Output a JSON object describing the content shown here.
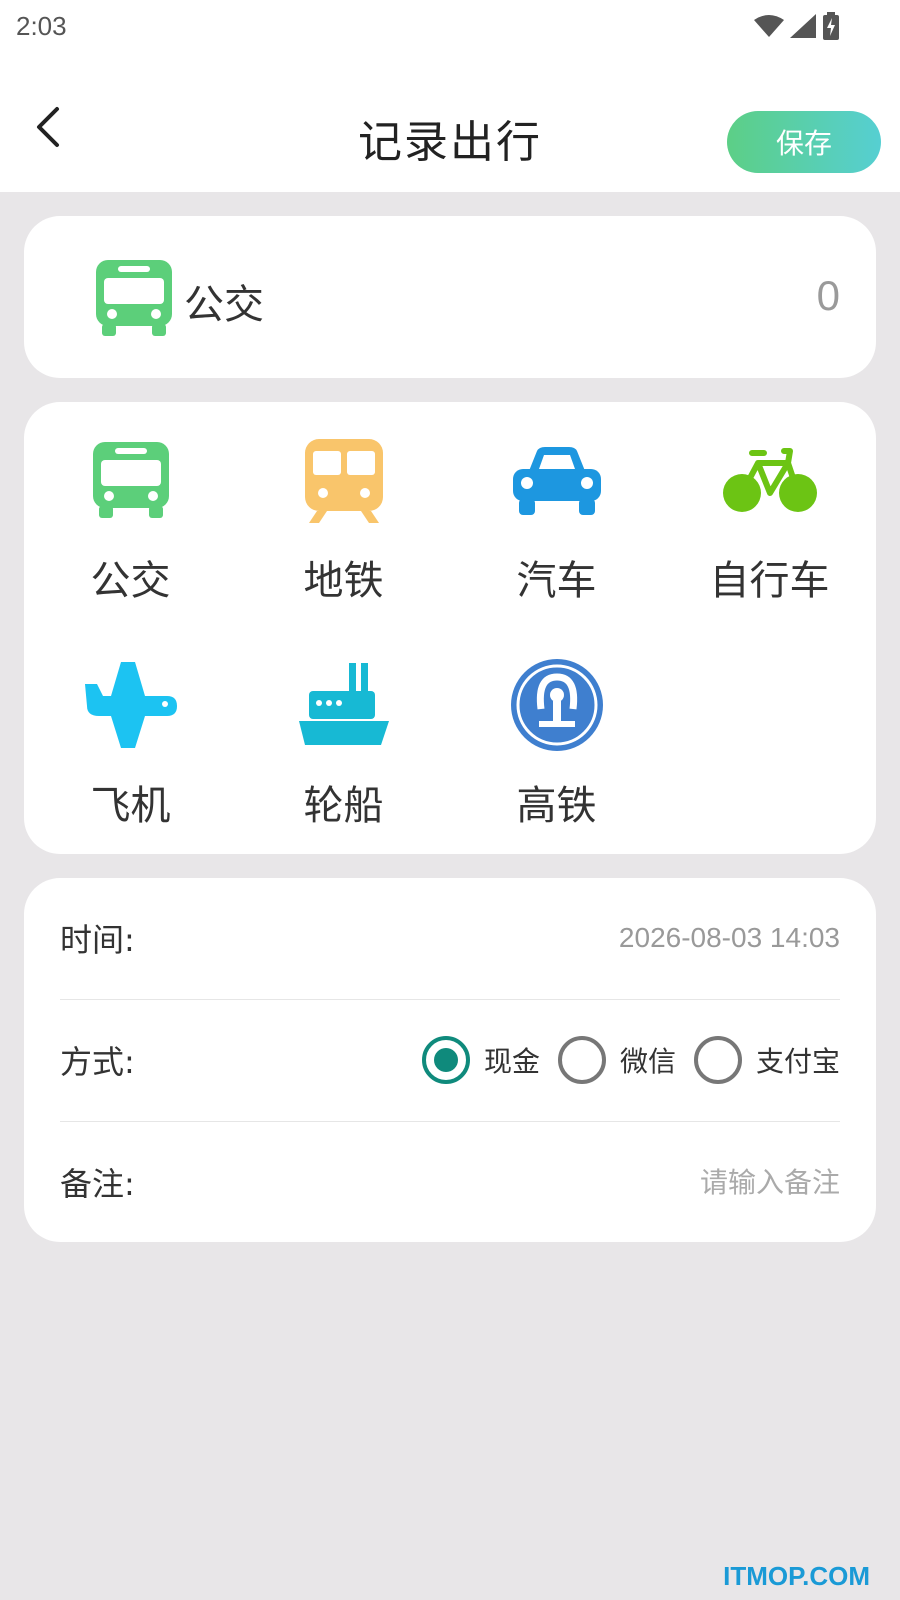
{
  "status_bar": {
    "time": "2:03"
  },
  "header": {
    "title": "记录出行",
    "save_label": "保存"
  },
  "selected": {
    "name": "公交",
    "amount": "0"
  },
  "transport_modes": [
    {
      "label": "公交",
      "icon": "bus-icon",
      "color": "#5ccf7a"
    },
    {
      "label": "地铁",
      "icon": "subway-icon",
      "color": "#f9c56b"
    },
    {
      "label": "汽车",
      "icon": "car-icon",
      "color": "#1d97e0"
    },
    {
      "label": "自行车",
      "icon": "bicycle-icon",
      "color": "#6cc414"
    },
    {
      "label": "飞机",
      "icon": "airplane-icon",
      "color": "#1cc3f2"
    },
    {
      "label": "轮船",
      "icon": "ship-icon",
      "color": "#17b9d4"
    },
    {
      "label": "高铁",
      "icon": "high-speed-rail-icon",
      "color": "#3f7fcf"
    }
  ],
  "form": {
    "time_label": "时间:",
    "time_value": "2026-08-03 14:03",
    "method_label": "方式:",
    "methods": [
      "现金",
      "微信",
      "支付宝"
    ],
    "selected_method": "现金",
    "note_label": "备注:",
    "note_placeholder": "请输入备注"
  },
  "watermark": "ITMOP.COM",
  "colors": {
    "accent": "#0f8a7c",
    "save_gradient_start": "#5ccf86",
    "save_gradient_end": "#56cfd2"
  }
}
